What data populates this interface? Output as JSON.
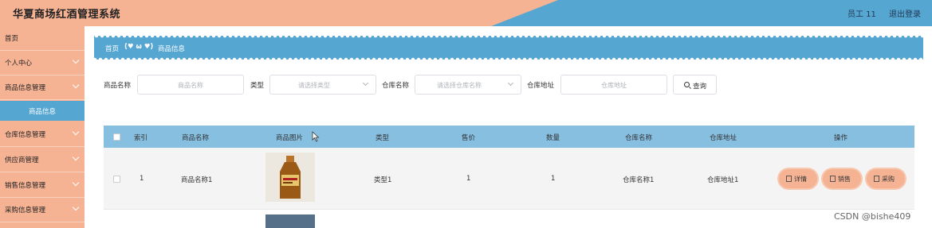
{
  "header": {
    "app_title": "华夏商场红酒管理系统",
    "user_label": "员工 11",
    "logout_label": "退出登录",
    "colors": {
      "left": "#f6b394",
      "right": "#56a6d2"
    }
  },
  "sidebar": {
    "items": [
      {
        "label": "首页"
      },
      {
        "label": "个人中心"
      },
      {
        "label": "商品信息管理"
      },
      {
        "label": "仓库信息管理"
      },
      {
        "label": "供应商管理"
      },
      {
        "label": "销售信息管理"
      },
      {
        "label": "采购信息管理"
      }
    ],
    "active_sub": "商品信息"
  },
  "breadcrumb": {
    "home": "首页",
    "separator": "(♥ ω ♥)",
    "current": "商品信息"
  },
  "search": {
    "name_label": "商品名称",
    "name_placeholder": "商品名称",
    "type_label": "类型",
    "type_placeholder": "请选择类型",
    "warehouse_label": "仓库名称",
    "warehouse_placeholder": "请选择仓库名称",
    "address_label": "仓库地址",
    "address_placeholder": "仓库地址",
    "button_label": "查询"
  },
  "table": {
    "columns": [
      "索引",
      "商品名称",
      "商品图片",
      "类型",
      "售价",
      "数量",
      "仓库名称",
      "仓库地址",
      "操作"
    ],
    "rows": [
      {
        "index": "1",
        "name": "商品名称1",
        "type": "类型1",
        "price": "1",
        "qty": "1",
        "warehouse": "仓库名称1",
        "address": "仓库地址1"
      }
    ],
    "actions": [
      "详情",
      "销售",
      "采购"
    ]
  },
  "watermark": "CSDN @bishe409"
}
